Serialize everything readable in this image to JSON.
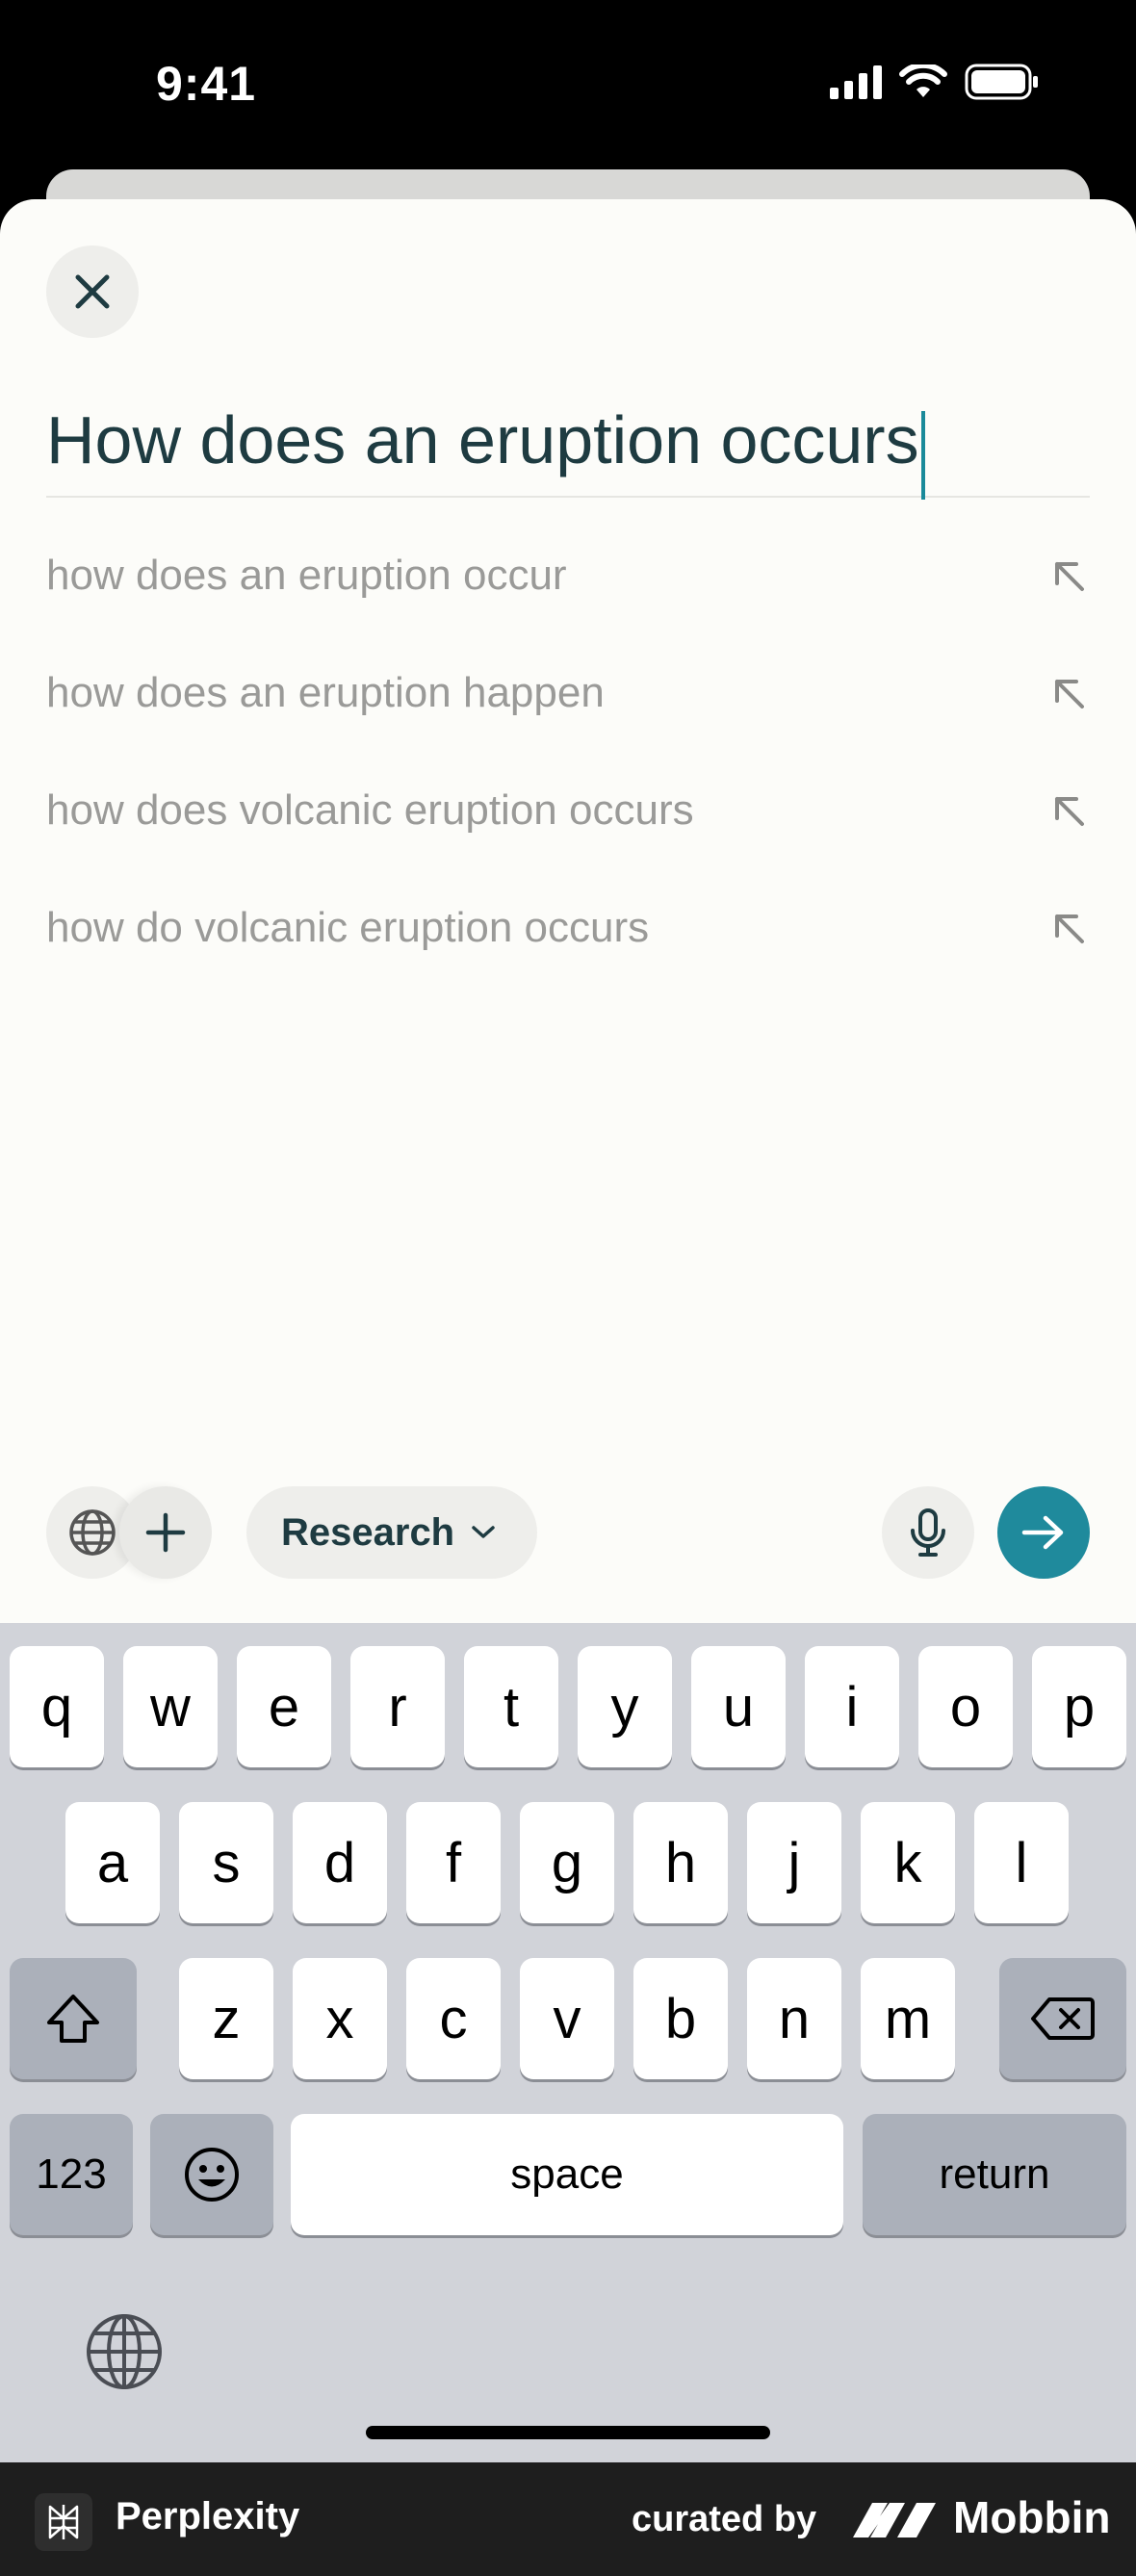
{
  "status_bar": {
    "time": "9:41"
  },
  "search": {
    "query": "How does an eruption occurs",
    "suggestions": [
      {
        "label": "how does an eruption occur"
      },
      {
        "label": "how does an eruption happen"
      },
      {
        "label": "how does volcanic eruption occurs"
      },
      {
        "label": "how do volcanic eruption occurs"
      }
    ]
  },
  "toolbar": {
    "mode_label": "Research"
  },
  "keyboard": {
    "row1": [
      "q",
      "w",
      "e",
      "r",
      "t",
      "y",
      "u",
      "i",
      "o",
      "p"
    ],
    "row2": [
      "a",
      "s",
      "d",
      "f",
      "g",
      "h",
      "j",
      "k",
      "l"
    ],
    "row3": [
      "z",
      "x",
      "c",
      "v",
      "b",
      "n",
      "m"
    ],
    "numbers_label": "123",
    "space_label": "space",
    "return_label": "return"
  },
  "footer": {
    "app_name": "Perplexity",
    "curated_by": "curated by",
    "brand": "Mobbin"
  },
  "colors": {
    "accent": "#1f8a9c",
    "text_dark": "#1e3b41",
    "suggestion_text": "#9a9a98"
  },
  "icons": [
    "close-icon",
    "arrow-up-left-icon",
    "globe-icon",
    "plus-icon",
    "chevron-down-icon",
    "microphone-icon",
    "arrow-right-icon",
    "shift-icon",
    "backspace-icon",
    "emoji-icon"
  ]
}
